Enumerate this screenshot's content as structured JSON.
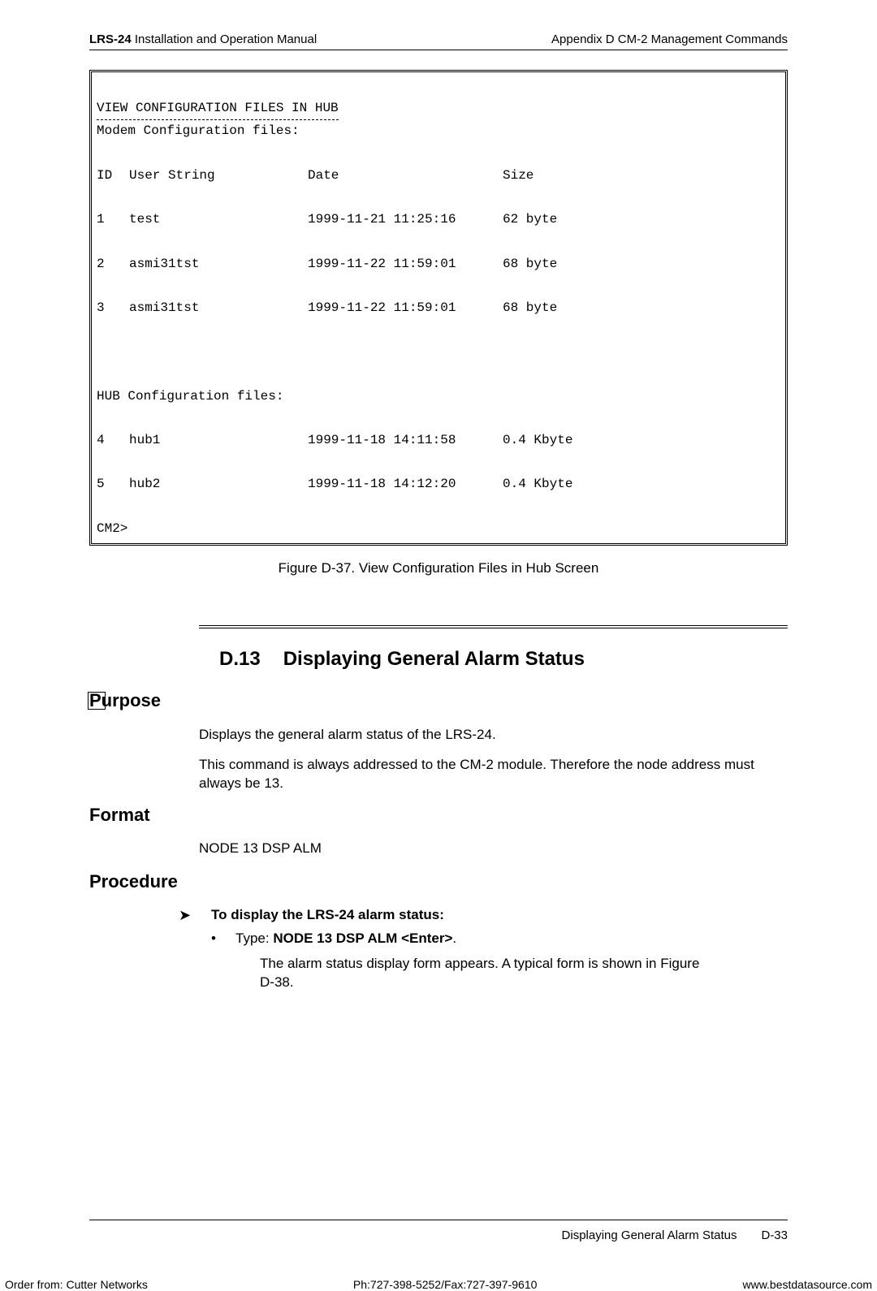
{
  "header": {
    "left_bold": "LRS-24",
    "left_rest": " Installation and Operation Manual",
    "right": "Appendix D  CM-2 Management Commands"
  },
  "terminal": {
    "title": "VIEW CONFIGURATION FILES IN HUB",
    "modem_header": "Modem Configuration files:",
    "cols": {
      "id": "ID",
      "user": "User String",
      "date": "Date",
      "size": "Size"
    },
    "modem_rows": [
      {
        "id": "1",
        "user": "test",
        "date": "1999-11-21 11:25:16",
        "size": "62 byte"
      },
      {
        "id": "2",
        "user": "asmi31tst",
        "date": "1999-11-22 11:59:01",
        "size": "68 byte"
      },
      {
        "id": "3",
        "user": "asmi31tst",
        "date": "1999-11-22 11:59:01",
        "size": "68 byte"
      }
    ],
    "hub_header": "HUB Configuration files:",
    "hub_rows": [
      {
        "id": "4",
        "user": "hub1",
        "date": "1999-11-18 14:11:58",
        "size": "0.4 Kbyte"
      },
      {
        "id": "5",
        "user": "hub2",
        "date": "1999-11-18 14:12:20",
        "size": "0.4 Kbyte"
      }
    ],
    "prompt": "CM2>"
  },
  "figure_caption": "Figure D-37.  View Configuration Files in Hub Screen",
  "section": {
    "num": "D.13",
    "title": "Displaying General Alarm Status"
  },
  "purpose": {
    "heading": "Purpose",
    "p1": "Displays the general alarm status of the LRS-24.",
    "p2": "This command is always addressed to the CM-2 module. Therefore the node address must always be 13."
  },
  "format": {
    "heading": "Format",
    "text": "NODE 13 DSP ALM"
  },
  "procedure": {
    "heading": "Procedure",
    "arrow": "➤",
    "proc_title": "To display the LRS-24 alarm status:",
    "bullet": "•",
    "type_prefix": "Type: ",
    "type_bold": "NODE 13 DSP ALM <Enter>",
    "type_suffix": ".",
    "sub": "The alarm status display form appears. A typical form is shown in Figure D-38."
  },
  "footer": {
    "section": "Displaying General Alarm Status",
    "page": "D-33"
  },
  "bottom": {
    "left": "Order from: Cutter Networks",
    "center": "Ph:727-398-5252/Fax:727-397-9610",
    "right": "www.bestdatasource.com"
  }
}
